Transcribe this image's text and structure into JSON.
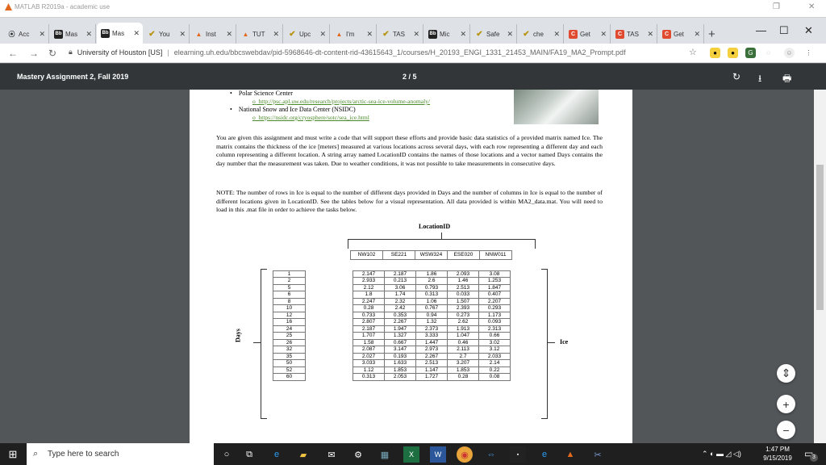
{
  "app_title": "MATLAB R2019a - academic use",
  "tabs": [
    {
      "label": "Acc",
      "icon": "ac"
    },
    {
      "label": "Mas",
      "icon": "bb"
    },
    {
      "label": "Mas",
      "icon": "bb"
    },
    {
      "label": "You",
      "icon": "chk"
    },
    {
      "label": "Inst",
      "icon": "ms"
    },
    {
      "label": "TUT",
      "icon": "ms"
    },
    {
      "label": "Upc",
      "icon": "chk"
    },
    {
      "label": "I'm",
      "icon": "ms"
    },
    {
      "label": "TAS",
      "icon": "chk"
    },
    {
      "label": "Mic",
      "icon": "bb"
    },
    {
      "label": "Safe",
      "icon": "chk"
    },
    {
      "label": "che",
      "icon": "chk"
    },
    {
      "label": "Get",
      "icon": "cg"
    },
    {
      "label": "TAS",
      "icon": "cg"
    },
    {
      "label": "Get",
      "icon": "cg"
    }
  ],
  "tab_favicon_text": {
    "bb": "Bb",
    "cg": "C",
    "ms": "▲",
    "chk": "✔",
    "ac": "⦿"
  },
  "address": {
    "site": "University of Houston [US]",
    "separator": "|",
    "url": "elearning.uh.edu/bbcswebdav/pid-5968646-dt-content-rid-43615643_1/courses/H_20193_ENGI_1331_21453_MAIN/FA19_MA2_Prompt.pdf"
  },
  "pdf": {
    "title": "Mastery Assignment 2, Fall 2019",
    "page_indicator": "2 / 5"
  },
  "doc": {
    "bullets": [
      {
        "text": "Polar Science Center",
        "sub": "http://psc.apl.uw.edu/research/projects/arctic-sea-ice-volume-anomaly/"
      },
      {
        "text": "National Snow and Ice Data Center (NSIDC)",
        "sub": "https://nsidc.org/cryosphere/sotc/sea_ice.html"
      }
    ],
    "para1": "You are given this assignment and must write a code that will support these efforts and provide basic data statistics of a provided matrix named Ice. The matrix contains the thickness of the ice [meters] measured at various locations across several days, with each row representing a different day and each column representing a different location. A string array named LocationID contains the names of those locations and a vector named Days contains the day number that the measurement was taken. Due to weather conditions, it was not possible to take measurements in consecutive days.",
    "para2": "NOTE: The number of rows in Ice is equal to the number of different days provided in Days and the number of columns in Ice is equal to the number of different locations given in LocationID. See the tables below for a visual representation. All data provided is within MA2_data.mat.  You will need to load in this .mat file in order to achieve the tasks below.",
    "location_label": "LocationID",
    "days_label": "Days",
    "ice_label": "Ice",
    "locations": [
      "NW102",
      "SE221",
      "WSW324",
      "ESE020",
      "NNW011"
    ],
    "days": [
      "1",
      "2",
      "5",
      "6",
      "8",
      "10",
      "12",
      "16",
      "24",
      "25",
      "26",
      "32",
      "35",
      "50",
      "52",
      "60"
    ],
    "ice": [
      [
        "2.147",
        "2.187",
        "1.86",
        "2.093",
        "3.08"
      ],
      [
        "2.933",
        "0.213",
        "2.6",
        "1.46",
        "1.253"
      ],
      [
        "2.12",
        "3.06",
        "0.793",
        "2.513",
        "1.847"
      ],
      [
        "1.8",
        "1.74",
        "0.313",
        "0.033",
        "0.407"
      ],
      [
        "2.247",
        "2.32",
        "1.06",
        "1.507",
        "2.207"
      ],
      [
        "0.28",
        "2.42",
        "0.767",
        "2.393",
        "0.293"
      ],
      [
        "0.733",
        "0.353",
        "0.94",
        "0.273",
        "1.173"
      ],
      [
        "2.807",
        "2.267",
        "1.32",
        "2.62",
        "0.093"
      ],
      [
        "2.187",
        "1.947",
        "2.373",
        "1.913",
        "2.313"
      ],
      [
        "1.707",
        "1.327",
        "3.333",
        "1.047",
        "0.66"
      ],
      [
        "1.58",
        "0.667",
        "1.447",
        "0.46",
        "3.02"
      ],
      [
        "2.087",
        "3.147",
        "2.973",
        "2.113",
        "3.12"
      ],
      [
        "2.027",
        "0.193",
        "2.267",
        "2.7",
        "2.033"
      ],
      [
        "3.033",
        "1.633",
        "2.513",
        "3.207",
        "2.14"
      ],
      [
        "1.12",
        "1.853",
        "1.147",
        "1.853",
        "0.22"
      ],
      [
        "0.313",
        "2.053",
        "1.727",
        "0.28",
        "0.08"
      ]
    ]
  },
  "taskbar": {
    "search_placeholder": "Type here to search",
    "time": "1:47 PM",
    "date": "9/15/2019",
    "notification_count": "3"
  }
}
